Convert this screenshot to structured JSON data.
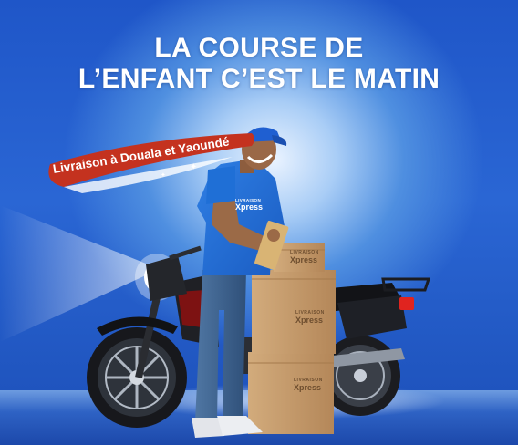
{
  "headline": {
    "line1": "LA COURSE DE",
    "line2": "L’ENFANT C’EST LE MATIN"
  },
  "badge": {
    "text": "Livraison à Douala et Yaoundé",
    "color": "#c4321f"
  },
  "brand": {
    "small": "LIVRAISON",
    "name": "Xpress"
  },
  "colors": {
    "background": "#2159c8",
    "shirt": "#1f6fd6",
    "cap": "#1f5fd1",
    "jeans": "#41658f",
    "box": "#c49b6c",
    "headline_text": "#ffffff"
  },
  "icons": {
    "sparkle": "sparkle-icon",
    "brand_mark": "x-logo-icon"
  }
}
